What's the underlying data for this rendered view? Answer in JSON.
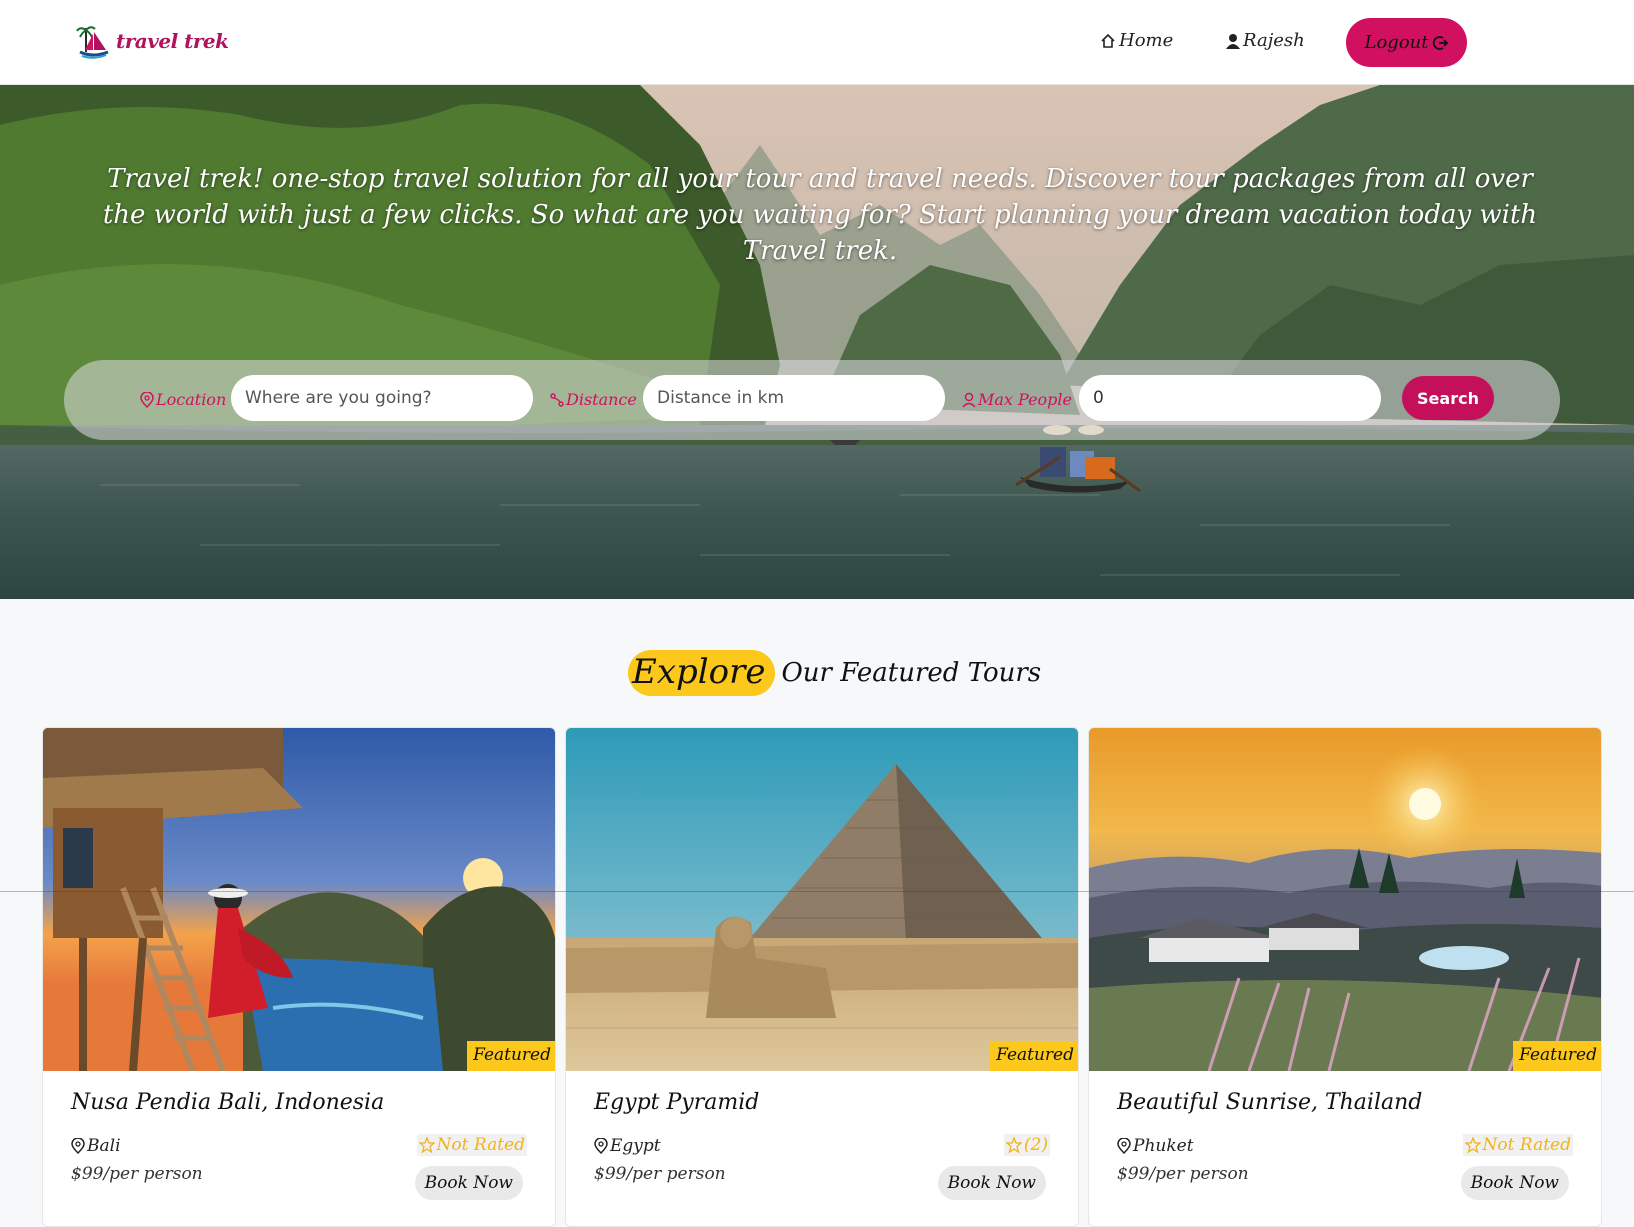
{
  "navbar": {
    "logo_text": "travel trek",
    "home_label": "Home",
    "user_label": "Rajesh",
    "logout_label": "Logout"
  },
  "hero": {
    "tagline": "Travel trek! one-stop travel solution for all your tour and travel needs. Discover tour packages from all over the world with just a few clicks. So what are you waiting for? Start planning your dream vacation today with Travel trek."
  },
  "search": {
    "location_label": "Location",
    "location_placeholder": "Where are you going?",
    "distance_label": "Distance",
    "distance_placeholder": "Distance in km",
    "people_label": "Max People",
    "people_value": "0",
    "button_label": "Search"
  },
  "featured": {
    "title_highlight": "Explore",
    "title_rest": "Our Featured Tours",
    "tours": [
      {
        "title": "Nusa Pendia Bali, Indonesia",
        "location": "Bali",
        "rating": "Not Rated",
        "price": "$99/per person",
        "badge": "Featured",
        "book": "Book Now"
      },
      {
        "title": "Egypt Pyramid",
        "location": "Egypt",
        "rating": "(2)",
        "price": "$99/per person",
        "badge": "Featured",
        "book": "Book Now"
      },
      {
        "title": "Beautiful Sunrise, Thailand",
        "location": "Phuket",
        "rating": "Not Rated",
        "price": "$99/per person",
        "badge": "Featured",
        "book": "Book Now"
      }
    ]
  },
  "colors": {
    "brand": "#d1105f",
    "highlight": "#fbc81b",
    "rating": "#f2b21a"
  },
  "icons": [
    "home-icon",
    "user-icon",
    "logout-icon",
    "location-pin-icon",
    "distance-icon",
    "people-icon",
    "star-icon"
  ]
}
